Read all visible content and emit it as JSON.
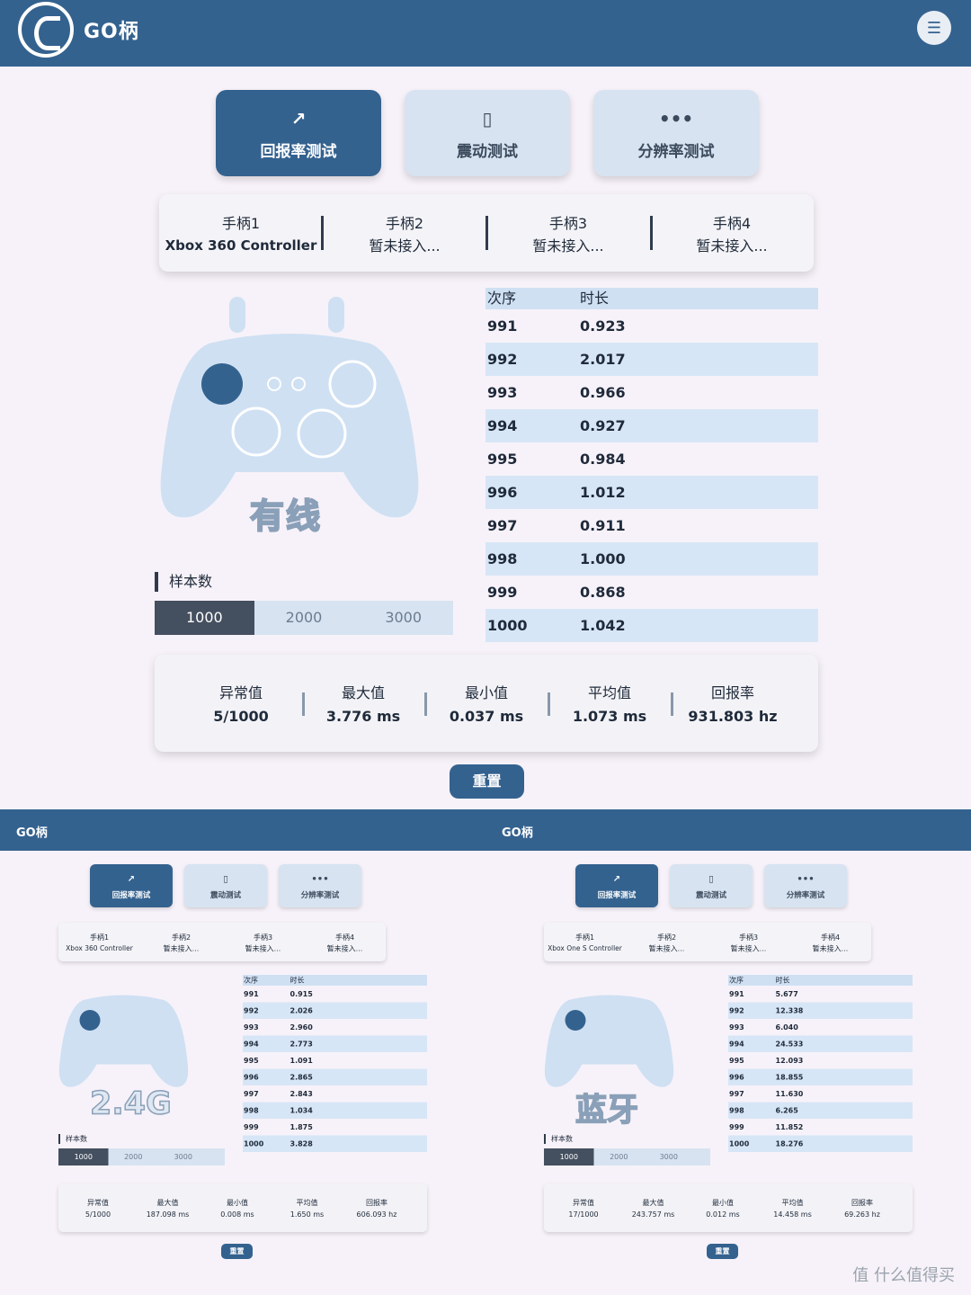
{
  "header": {
    "brand": "GO柄"
  },
  "tabs": [
    {
      "label": "回报率测试",
      "icon": "trend-icon"
    },
    {
      "label": "震动测试",
      "icon": "vibrate-icon"
    },
    {
      "label": "分辨率测试",
      "icon": "dots-icon"
    }
  ],
  "gamepads": [
    {
      "name": "手柄1",
      "status": "Xbox 360 Controller"
    },
    {
      "name": "手柄2",
      "status": "暂未接入..."
    },
    {
      "name": "手柄3",
      "status": "暂未接入..."
    },
    {
      "name": "手柄4",
      "status": "暂未接入..."
    }
  ],
  "mode": "有线",
  "samples": {
    "title": "样本数",
    "options": [
      "1000",
      "2000",
      "3000"
    ],
    "selected": "1000"
  },
  "table": {
    "headers": [
      "次序",
      "时长"
    ],
    "rows": [
      [
        "991",
        "0.923"
      ],
      [
        "992",
        "2.017"
      ],
      [
        "993",
        "0.966"
      ],
      [
        "994",
        "0.927"
      ],
      [
        "995",
        "0.984"
      ],
      [
        "996",
        "1.012"
      ],
      [
        "997",
        "0.911"
      ],
      [
        "998",
        "1.000"
      ],
      [
        "999",
        "0.868"
      ],
      [
        "1000",
        "1.042"
      ]
    ]
  },
  "stats": [
    {
      "label": "异常值",
      "value": "5/1000"
    },
    {
      "label": "最大值",
      "value": "3.776 ms"
    },
    {
      "label": "最小值",
      "value": "0.037 ms"
    },
    {
      "label": "平均值",
      "value": "1.073 ms"
    },
    {
      "label": "回报率",
      "value": "931.803 hz"
    }
  ],
  "reset_label": "重置",
  "mini_left": {
    "brand": "GO柄",
    "mode": "2.4G",
    "pad1": "Xbox 360 Controller",
    "rows": [
      [
        "991",
        "0.915"
      ],
      [
        "992",
        "2.026"
      ],
      [
        "993",
        "2.960"
      ],
      [
        "994",
        "2.773"
      ],
      [
        "995",
        "1.091"
      ],
      [
        "996",
        "2.865"
      ],
      [
        "997",
        "2.843"
      ],
      [
        "998",
        "1.034"
      ],
      [
        "999",
        "1.875"
      ],
      [
        "1000",
        "3.828"
      ]
    ],
    "stats": [
      "5/1000",
      "187.098 ms",
      "0.008 ms",
      "1.650 ms",
      "606.093 hz"
    ]
  },
  "mini_right": {
    "brand": "GO柄",
    "mode": "蓝牙",
    "pad1": "Xbox One S Controller",
    "rows": [
      [
        "991",
        "5.677"
      ],
      [
        "992",
        "12.338"
      ],
      [
        "993",
        "6.040"
      ],
      [
        "994",
        "24.533"
      ],
      [
        "995",
        "12.093"
      ],
      [
        "996",
        "18.855"
      ],
      [
        "997",
        "11.630"
      ],
      [
        "998",
        "6.265"
      ],
      [
        "999",
        "11.852"
      ],
      [
        "1000",
        "18.276"
      ]
    ],
    "stats": [
      "17/1000",
      "243.757 ms",
      "0.012 ms",
      "14.458 ms",
      "69.263 hz"
    ]
  },
  "watermark": "值 什么值得买"
}
